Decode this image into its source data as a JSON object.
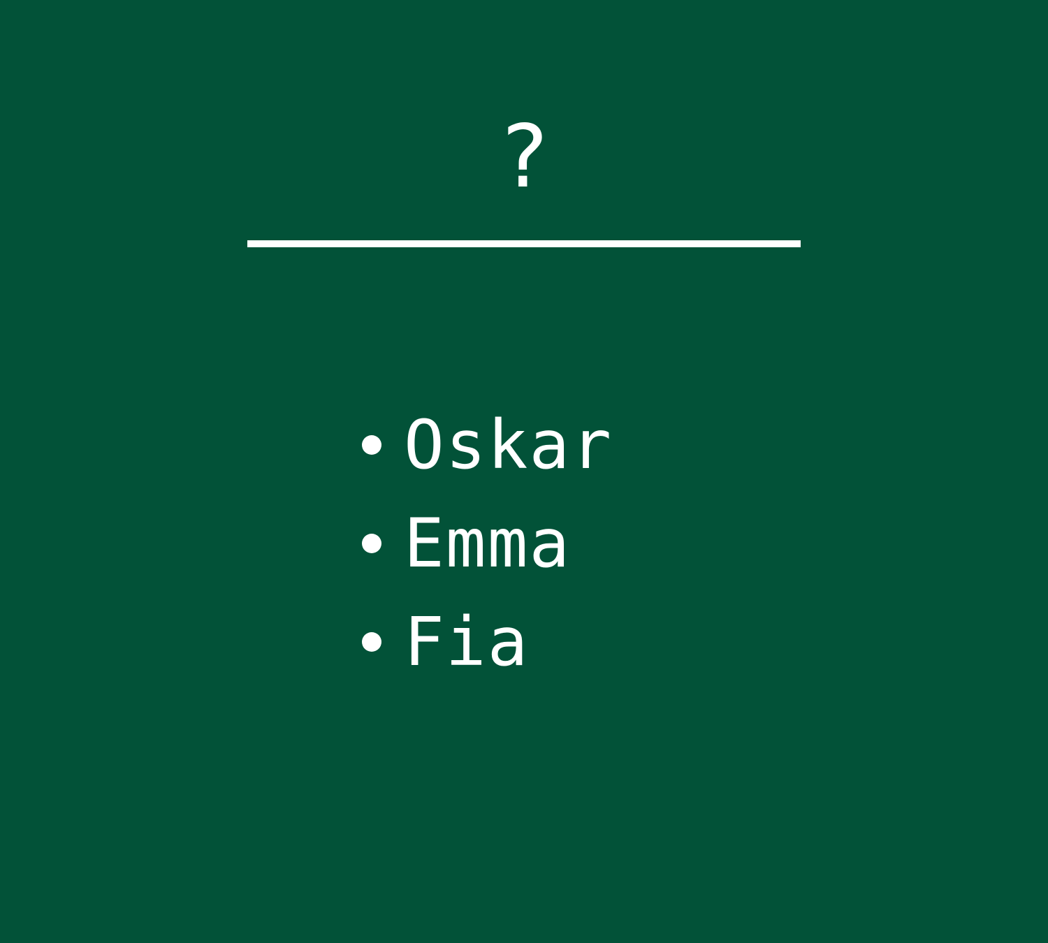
{
  "colors": {
    "background": "#025238",
    "foreground": "#FFFFFF"
  },
  "heading": "?",
  "list": {
    "items": [
      {
        "label": "Oskar"
      },
      {
        "label": "Emma"
      },
      {
        "label": "Fia"
      }
    ]
  }
}
